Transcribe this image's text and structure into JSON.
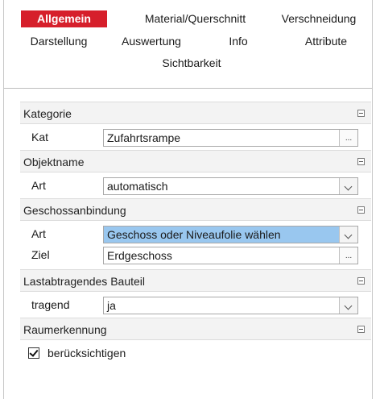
{
  "tabs": [
    {
      "label": "Allgemein",
      "active": true
    },
    {
      "label": "Material/Querschnitt",
      "active": false
    },
    {
      "label": "Verschneidung",
      "active": false
    },
    {
      "label": "Darstellung",
      "active": false
    },
    {
      "label": "Auswertung",
      "active": false
    },
    {
      "label": "Info",
      "active": false
    },
    {
      "label": "Attribute",
      "active": false
    },
    {
      "label": "Sichtbarkeit",
      "active": false
    }
  ],
  "accent_color": "#d61f2b",
  "selection_color": "#99c7ef",
  "groups": {
    "kategorie": {
      "title": "Kategorie",
      "kat": {
        "label": "Kat",
        "value": "Zufahrtsrampe",
        "button": "..."
      }
    },
    "objektname": {
      "title": "Objektname",
      "art": {
        "label": "Art",
        "value": "automatisch"
      }
    },
    "geschossanbindung": {
      "title": "Geschossanbindung",
      "art": {
        "label": "Art",
        "value": "Geschoss oder Niveaufolie wählen"
      },
      "ziel": {
        "label": "Ziel",
        "value": "Erdgeschoss",
        "button": "..."
      }
    },
    "lastabtragendes": {
      "title": "Lastabtragendes Bauteil",
      "tragend": {
        "label": "tragend",
        "value": "ja"
      }
    },
    "raumerkennung": {
      "title": "Raumerkennung",
      "checkbox": {
        "label": "berücksichtigen",
        "checked": true
      }
    }
  }
}
